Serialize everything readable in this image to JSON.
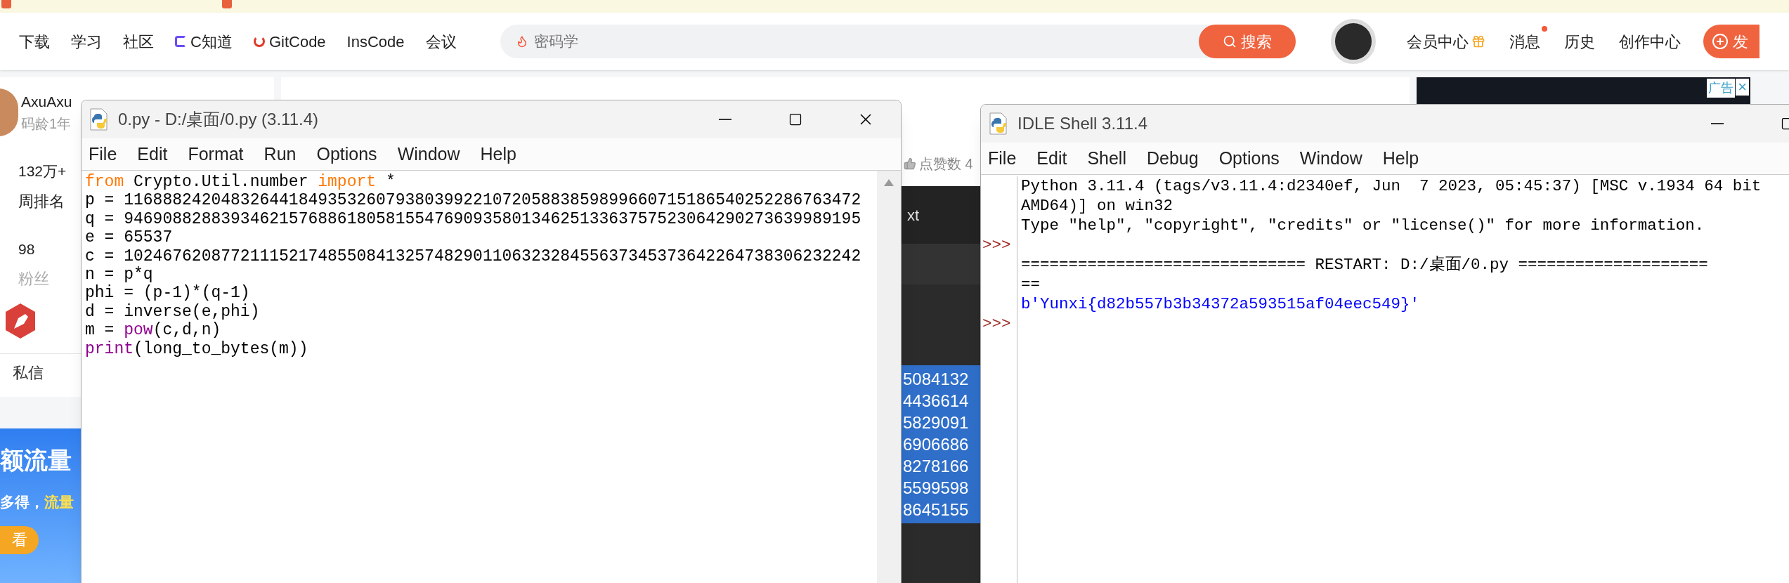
{
  "nav": {
    "items": [
      {
        "label": "下载",
        "kind": "plain"
      },
      {
        "label": "学习",
        "kind": "plain"
      },
      {
        "label": "社区",
        "kind": "plain"
      },
      {
        "label": "C知道",
        "kind": "cknow"
      },
      {
        "label": "GitCode",
        "kind": "gitcode"
      },
      {
        "label": "InsCode",
        "kind": "plain"
      },
      {
        "label": "会议",
        "kind": "plain"
      }
    ],
    "search": {
      "placeholder": "密码学",
      "button": "搜索"
    },
    "user_links": [
      {
        "label": "会员中心",
        "kind": "vip"
      },
      {
        "label": "消息",
        "kind": "notify"
      },
      {
        "label": "历史",
        "kind": "plain"
      },
      {
        "label": "创作中心",
        "kind": "plain"
      }
    ],
    "publish_button": "发"
  },
  "profile": {
    "name": "AxuAxu",
    "code_age": "码龄1年",
    "stats": [
      {
        "value": "132万+",
        "label": "周排名",
        "kind": "rank"
      },
      {
        "value": "98",
        "label": "粉丝",
        "kind": "fans"
      }
    ],
    "message": "私信"
  },
  "banner": {
    "headline": "额流量",
    "subline": "多得，",
    "highlight": "流量",
    "button": "看"
  },
  "article": {
    "likes": "点赞数 4"
  },
  "background_editor": {
    "tab": "xt",
    "selected_lines": [
      "5084132",
      "4436614",
      "5829091",
      "6906686",
      "8278166",
      "5599598",
      "8645155"
    ]
  },
  "ad": {
    "label": "广告",
    "close": "×"
  },
  "editor": {
    "title": "0.py - D:/桌面/0.py (3.11.4)",
    "menu": [
      "File",
      "Edit",
      "Format",
      "Run",
      "Options",
      "Window",
      "Help"
    ],
    "lines": [
      [
        {
          "text": "from",
          "kind": "keyword"
        },
        {
          "text": " Crypto.Util.number ",
          "kind": "plain"
        },
        {
          "text": "import",
          "kind": "keyword"
        },
        {
          "text": " *",
          "kind": "plain"
        }
      ],
      [
        {
          "text": "p = 1168882420483264418493532607938039922107205883859899660715186540252286763472",
          "kind": "plain"
        }
      ],
      [
        {
          "text": "q = 9469088288393462157688618058155476909358013462513363757523064290273639989195",
          "kind": "plain"
        }
      ],
      [
        {
          "text": "e = 65537",
          "kind": "plain"
        }
      ],
      [
        {
          "text": "c = 1024676208772111521748550841325748290110632328455637345373642264738306232242",
          "kind": "plain"
        }
      ],
      [
        {
          "text": "n = p*q",
          "kind": "plain"
        }
      ],
      [
        {
          "text": "phi = (p-1)*(q-1)",
          "kind": "plain"
        }
      ],
      [
        {
          "text": "d = inverse(e,phi)",
          "kind": "plain"
        }
      ],
      [
        {
          "text": "m = ",
          "kind": "plain"
        },
        {
          "text": "pow",
          "kind": "builtin"
        },
        {
          "text": "(c,d,n)",
          "kind": "plain"
        }
      ],
      [
        {
          "text": "print",
          "kind": "builtin"
        },
        {
          "text": "(long_to_bytes(m))",
          "kind": "plain"
        }
      ]
    ]
  },
  "shell": {
    "title": "IDLE Shell 3.11.4",
    "menu": [
      "File",
      "Edit",
      "Shell",
      "Debug",
      "Options",
      "Window",
      "Help"
    ],
    "lines": [
      {
        "text": "Python 3.11.4 (tags/v3.11.4:d2340ef, Jun  7 2023, 05:45:37) [MSC v.1934 64 bit",
        "kind": "output"
      },
      {
        "text": "AMD64)] on win32",
        "kind": "output"
      },
      {
        "text": "Type \"help\", \"copyright\", \"credits\" or \"license()\" for more information.",
        "kind": "output"
      },
      {
        "prompt": ">>>"
      },
      {
        "text": "============================== RESTART: D:/桌面/0.py ====================",
        "kind": "output"
      },
      {
        "text": "==",
        "kind": "output"
      },
      {
        "text": "b'Yunxi{d82b557b3b34372a593515af04eec549}'",
        "kind": "stdout"
      },
      {
        "prompt": ">>>"
      }
    ]
  }
}
